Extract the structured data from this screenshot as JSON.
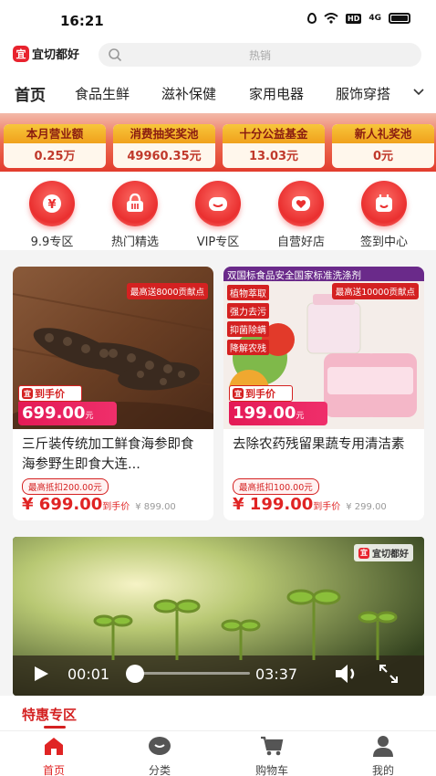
{
  "status_bar": {
    "time": "16:21",
    "hd": "HD",
    "signal": "4G"
  },
  "header": {
    "logo_text": "宜切都好",
    "logo_mark": "宜",
    "search_placeholder": "热销"
  },
  "categories": [
    {
      "label": "首页",
      "active": true
    },
    {
      "label": "食品生鲜"
    },
    {
      "label": "滋补保健"
    },
    {
      "label": "家用电器"
    },
    {
      "label": "服饰穿搭"
    }
  ],
  "stats": [
    {
      "title": "本月营业额",
      "value": "0.25万"
    },
    {
      "title": "消费抽奖奖池",
      "value": "49960.35元"
    },
    {
      "title": "十分公益基金",
      "value": "13.03元"
    },
    {
      "title": "新人礼奖池",
      "value": "0元"
    }
  ],
  "shortcuts": [
    {
      "label": "9.9专区",
      "icon": "yen-icon"
    },
    {
      "label": "热门精选",
      "icon": "shopping-basket-icon"
    },
    {
      "label": "VIP专区",
      "icon": "smile-icon"
    },
    {
      "label": "自营好店",
      "icon": "heart-icon"
    },
    {
      "label": "签到中心",
      "icon": "calendar-check-icon"
    }
  ],
  "products": [
    {
      "title": "三斤装传统加工鲜食海参即食海参野生即食大连...",
      "badge": "最高送8000贡献点",
      "tag_label": "到手价",
      "tag_price": "699.00",
      "tag_unit": "元",
      "deduct": "最高抵扣200.00元",
      "price": "¥ 699.00",
      "price_unit": "到手价",
      "old_price": "¥ 899.00"
    },
    {
      "title": "去除农药残留果蔬专用清洁素",
      "badge": "最高送10000贡献点",
      "banner": "双国标食品安全国家标准洗涤剂",
      "features": [
        "植物萃取",
        "强力去污",
        "抑菌除螨",
        "降解农残"
      ],
      "tag_label": "到手价",
      "tag_price": "199.00",
      "tag_unit": "元",
      "deduct": "最高抵扣100.00元",
      "price": "¥ 199.00",
      "price_unit": "到手价",
      "old_price": "¥ 299.00"
    }
  ],
  "video": {
    "logo_text": "宜切都好",
    "current_time": "00:01",
    "duration": "03:37",
    "progress": 0.0
  },
  "special": {
    "title": "特惠专区"
  },
  "tabbar": [
    {
      "label": "首页",
      "active": true,
      "icon": "home-icon"
    },
    {
      "label": "分类",
      "icon": "category-icon"
    },
    {
      "label": "购物车",
      "icon": "cart-icon"
    },
    {
      "label": "我的",
      "icon": "user-icon"
    }
  ],
  "colors": {
    "brand_red": "#e02424",
    "gold": "#f0a11c",
    "pink": "#e41a56"
  }
}
